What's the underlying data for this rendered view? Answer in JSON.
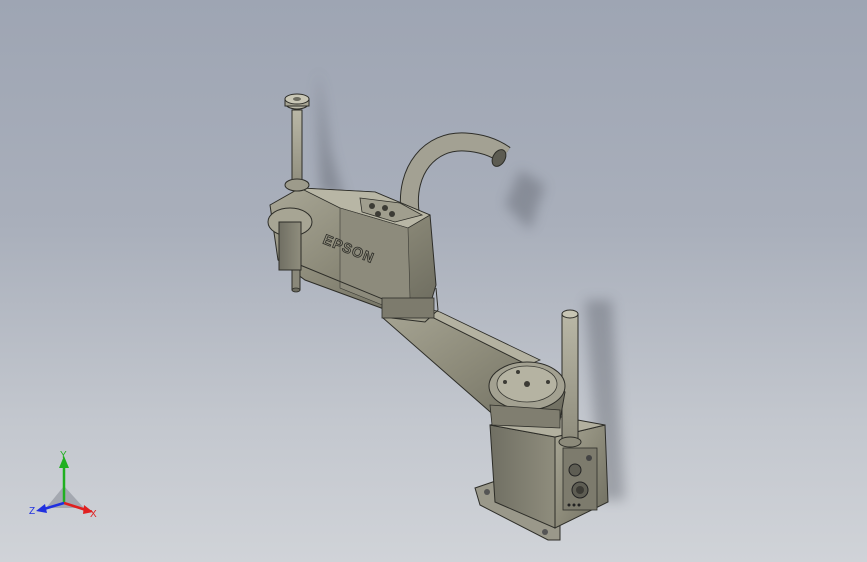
{
  "model": {
    "brand_text": "EPSON"
  },
  "triad": {
    "x_label": "X",
    "y_label": "Y",
    "z_label": "Z",
    "x_color": "#e02020",
    "y_color": "#20b020",
    "z_color": "#2030e0"
  },
  "icons": [
    "coordinate-triad-icon"
  ]
}
